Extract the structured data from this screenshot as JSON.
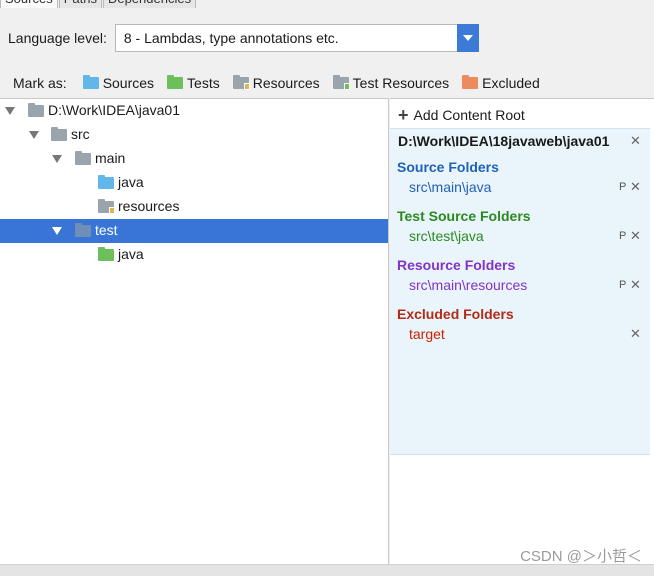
{
  "tabs": [
    {
      "label": "Sources"
    },
    {
      "label": "Paths"
    },
    {
      "label": "Dependencies"
    }
  ],
  "language_level": {
    "label": "Language level:",
    "value": "8 - Lambdas, type annotations etc."
  },
  "mark_as": {
    "label": "Mark as:",
    "buttons": [
      {
        "label": "Sources",
        "icon": "folder-sources-icon",
        "color": "#62b6e8"
      },
      {
        "label": "Tests",
        "icon": "folder-tests-icon",
        "color": "#6cbf5a"
      },
      {
        "label": "Resources",
        "icon": "folder-resources-icon",
        "color": "#9aa4ad"
      },
      {
        "label": "Test Resources",
        "icon": "folder-test-resources-icon",
        "color": "#9aa4ad"
      },
      {
        "label": "Excluded",
        "icon": "folder-excluded-icon",
        "color": "#ec8b5e"
      }
    ]
  },
  "tree": {
    "nodes": [
      {
        "label": "D:\\Work\\IDEA\\java01",
        "icon": "folder-gray-icon",
        "expanded": true,
        "selected": false
      },
      {
        "label": "src",
        "icon": "folder-gray-icon",
        "expanded": true,
        "selected": false
      },
      {
        "label": "main",
        "icon": "folder-gray-icon",
        "expanded": true,
        "selected": false
      },
      {
        "label": "java",
        "icon": "folder-sources-icon",
        "expanded": false,
        "selected": false
      },
      {
        "label": "resources",
        "icon": "folder-resources-icon",
        "expanded": false,
        "selected": false
      },
      {
        "label": "test",
        "icon": "folder-gray-icon",
        "expanded": true,
        "selected": true
      },
      {
        "label": "java",
        "icon": "folder-tests-icon",
        "expanded": false,
        "selected": false
      }
    ]
  },
  "content_root": {
    "add_label": "Add Content Root",
    "path": "D:\\Work\\IDEA\\18javaweb\\java01",
    "sections": [
      {
        "title": "Source Folders",
        "entry": "src\\main\\java",
        "color": "#1e62b8"
      },
      {
        "title": "Test Source Folders",
        "entry": "src\\test\\java",
        "color": "#2b8a1f"
      },
      {
        "title": "Resource Folders",
        "entry": "src\\main\\resources",
        "color": "#8233c8"
      },
      {
        "title": "Excluded Folders",
        "entry": "target",
        "color": "#b22c15"
      }
    ],
    "props_glyph": "P",
    "remove_glyph": "✕"
  },
  "watermark": "CSDN @＞小哲＜",
  "colors": {
    "selection": "#3875d7",
    "dropdown_arrow": "#3b7ad6",
    "root_panel_bg": "#eaf4fb"
  }
}
